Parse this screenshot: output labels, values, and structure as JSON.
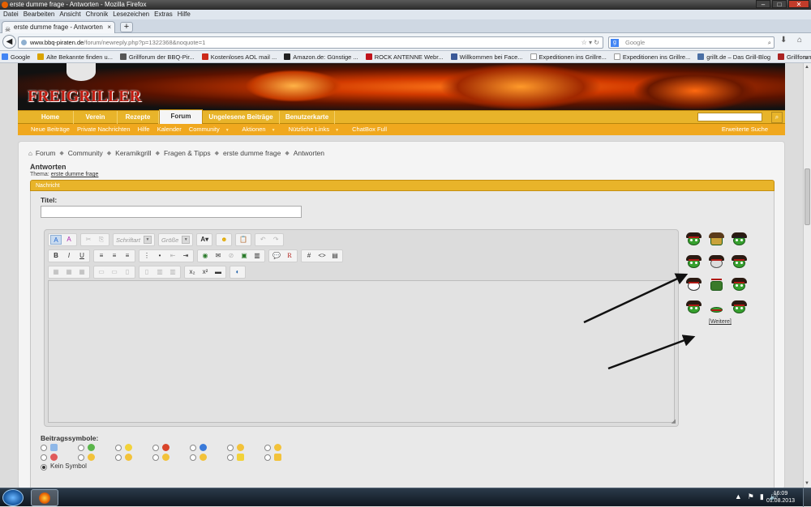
{
  "window": {
    "title": "erste dumme frage - Antworten - Mozilla Firefox"
  },
  "menubar": [
    "Datei",
    "Bearbeiten",
    "Ansicht",
    "Chronik",
    "Lesezeichen",
    "Extras",
    "Hilfe"
  ],
  "tab": {
    "title": "erste dumme frage - Antworten"
  },
  "url": {
    "host": "www.bbq-piraten.de",
    "path": "/forum/newreply.php?p=1322368&noquote=1"
  },
  "search": {
    "engine": "Google",
    "placeholder": "Google"
  },
  "bookmarks": [
    {
      "label": "Google",
      "color": "#4285f4"
    },
    {
      "label": "Alte Bekannte finden u...",
      "color": "#d9a300"
    },
    {
      "label": "Grillforum der BBQ-Pir...",
      "color": "#555555"
    },
    {
      "label": "Kostenloses AOL mail ...",
      "color": "#cc2a1a"
    },
    {
      "label": "Amazon.de: Günstige ...",
      "color": "#222222"
    },
    {
      "label": "ROCK ANTENNE Webr...",
      "color": "#c0121b"
    },
    {
      "label": "Willkommen bei Face...",
      "color": "#3b5998"
    },
    {
      "label": "Expeditionen ins Grillre...",
      "color": "#eeeeee"
    },
    {
      "label": "Expeditionen ins Grillre...",
      "color": "#eeeeee"
    },
    {
      "label": "grillt.de – Das Grill-Blog",
      "color": "#4a6fa5"
    },
    {
      "label": "Grillforum myBBQ.net ...",
      "color": "#aa2222"
    }
  ],
  "bookmarks_more": "»",
  "site": {
    "logo": "FREIGRILLER",
    "nav": [
      "Home",
      "Verein",
      "Rezepte",
      "Forum",
      "Ungelesene Beiträge",
      "Benutzerkarte"
    ],
    "nav_active": "Forum",
    "subnav": [
      "Neue Beiträge",
      "Private Nachrichten",
      "Hilfe",
      "Kalender",
      "Community",
      "Aktionen",
      "Nützliche Links",
      "ChatBox Full"
    ],
    "advanced_search": "Erweiterte Suche"
  },
  "breadcrumb": [
    "Forum",
    "Community",
    "Keramikgrill",
    "Fragen & Tipps",
    "erste dumme frage",
    "Antworten"
  ],
  "page": {
    "title": "Antworten",
    "thread_label": "Thema:",
    "thread_link": "erste dumme frage",
    "section_header": "Nachricht",
    "title_field_label": "Titel:",
    "font_select": "Schriftart",
    "size_select": "Größe",
    "more_smilies": "[Weitere]",
    "post_icons_label": "Beitragssymbole:",
    "no_icon_label": "Kein Symbol"
  },
  "taskbar": {
    "time": "16:09",
    "date": "01.08.2013"
  },
  "colors": {
    "accent": "#e8b42a",
    "subnav": "#f0a81e",
    "smiley_green": "#37a12f"
  }
}
